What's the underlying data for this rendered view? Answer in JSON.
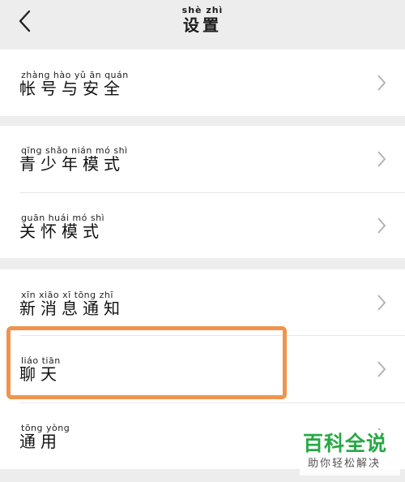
{
  "header": {
    "title_pinyin": "shè  zhì",
    "title": "设置",
    "back_icon": "chevron-left-icon"
  },
  "groups": [
    {
      "items": [
        {
          "pinyin": "zhàng hào   yǔ   ān  quán",
          "label": "帐号与安全",
          "icon": "chevron-right-icon"
        }
      ]
    },
    {
      "items": [
        {
          "pinyin": "qīng shǎo nián  mó   shì",
          "label": "青少年模式",
          "icon": "chevron-right-icon"
        },
        {
          "pinyin": "guān huái  mó   shì",
          "label": "关怀模式",
          "icon": "chevron-right-icon"
        }
      ]
    },
    {
      "items": [
        {
          "pinyin": "xīn  xiāo   xī  tōng  zhī",
          "label": "新消息通知",
          "icon": "chevron-right-icon"
        },
        {
          "pinyin": "liáo  tiān",
          "label": "聊天",
          "icon": "chevron-right-icon"
        },
        {
          "pinyin": "tōng yòng",
          "label": "通用",
          "icon": "chevron-right-icon"
        }
      ]
    }
  ],
  "watermark": {
    "main": "百科全说",
    "sub": "助你轻松解决"
  },
  "colors": {
    "highlight": "#f0944d",
    "watermark_green": "#27a845",
    "background": "#ededed"
  }
}
